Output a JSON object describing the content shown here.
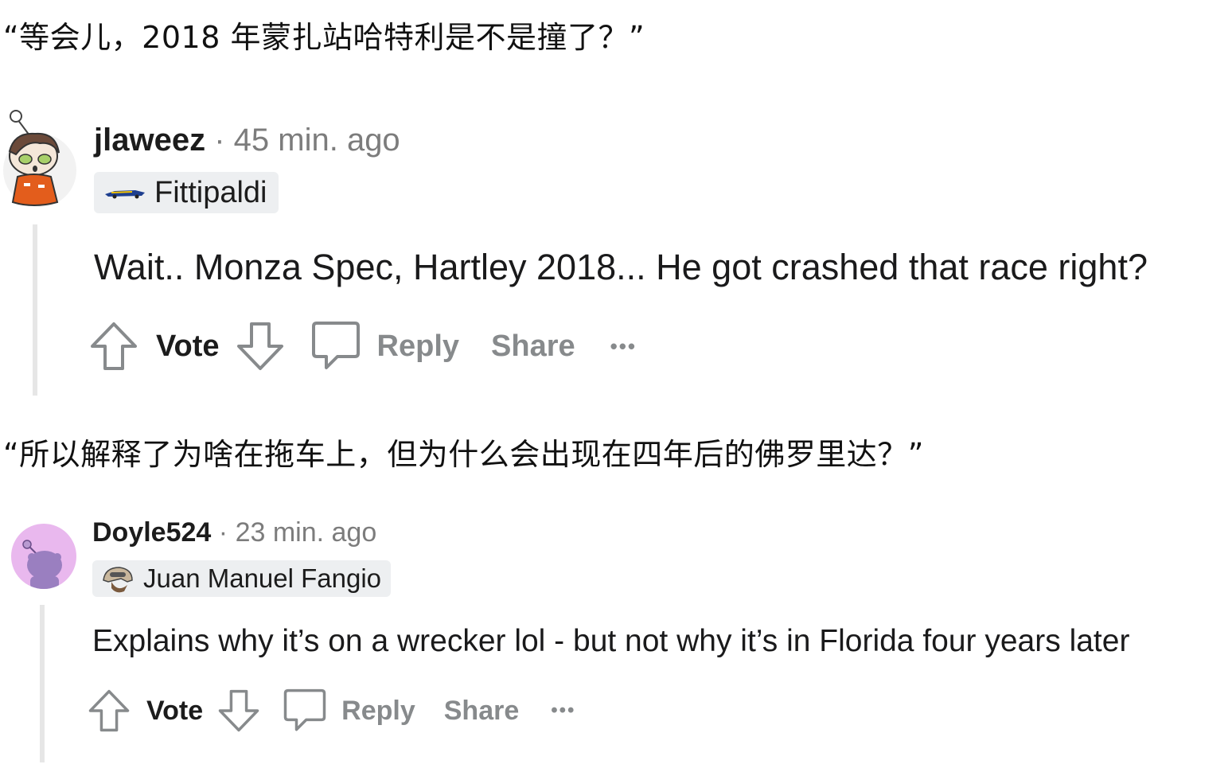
{
  "captions": {
    "first": "“等会儿，2018 年蒙扎站哈特利是不是撞了？”",
    "second": "“所以解释了为啥在拖车上，但为什么会出现在四年后的佛罗里达？”"
  },
  "comments": [
    {
      "username": "jlaweez",
      "separator": "·",
      "time": "45 min. ago",
      "flair": "Fittipaldi",
      "body": "Wait.. Monza Spec, Hartley 2018... He got crashed that race right?",
      "actions": {
        "vote": "Vote",
        "reply": "Reply",
        "share": "Share",
        "more": "•••"
      }
    },
    {
      "username": "Doyle524",
      "separator": "·",
      "time": "23 min. ago",
      "flair": "Juan Manuel Fangio",
      "body": "Explains why it’s on a wrecker lol - but not why it’s in Florida four years later",
      "actions": {
        "vote": "Vote",
        "reply": "Reply",
        "share": "Share",
        "more": "•••"
      }
    }
  ],
  "colors": {
    "muted": "#878a8c",
    "flair_bg": "#edeff1",
    "thread_line": "#e6e6e6",
    "avatar2_bg": "#e9b8ee"
  },
  "icons": [
    "upvote-arrow-icon",
    "downvote-arrow-icon",
    "comment-bubble-icon",
    "more-options-icon",
    "flair-car-icon",
    "flair-helmet-icon"
  ]
}
